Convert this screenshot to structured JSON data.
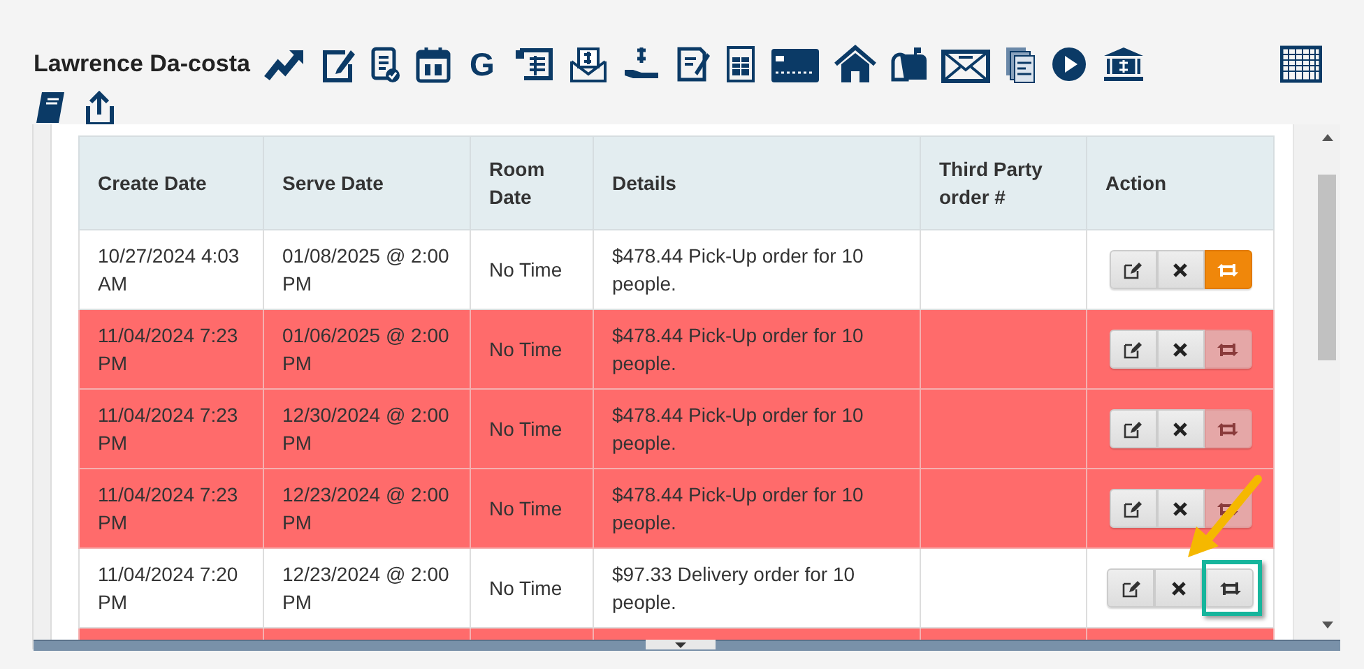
{
  "header": {
    "name": "Lawrence Da-costa",
    "letter_icon": "G"
  },
  "table": {
    "columns": [
      "Create Date",
      "Serve Date",
      "Room Date",
      "Details",
      "Third Party order #",
      "Action"
    ],
    "rows": [
      {
        "create_date": "10/27/2024 4:03 AM",
        "serve_date": "01/08/2025 @ 2:00 PM",
        "room_date": "No Time",
        "details": "$478.44 Pick-Up order for 10 people.",
        "highlighted": false,
        "repeat_active": true,
        "repeat_disabled": false,
        "callout": false
      },
      {
        "create_date": "11/04/2024 7:23 PM",
        "serve_date": "01/06/2025 @ 2:00 PM",
        "room_date": "No Time",
        "details": "$478.44 Pick-Up order for 10 people.",
        "highlighted": true,
        "repeat_active": false,
        "repeat_disabled": true,
        "callout": false
      },
      {
        "create_date": "11/04/2024 7:23 PM",
        "serve_date": "12/30/2024 @ 2:00 PM",
        "room_date": "No Time",
        "details": "$478.44 Pick-Up order for 10 people.",
        "highlighted": true,
        "repeat_active": false,
        "repeat_disabled": true,
        "callout": false
      },
      {
        "create_date": "11/04/2024 7:23 PM",
        "serve_date": "12/23/2024 @ 2:00 PM",
        "room_date": "No Time",
        "details": "$478.44 Pick-Up order for 10 people.",
        "highlighted": true,
        "repeat_active": false,
        "repeat_disabled": true,
        "callout": false
      },
      {
        "create_date": "11/04/2024 7:20 PM",
        "serve_date": "12/23/2024 @ 2:00 PM",
        "room_date": "No Time",
        "details": "$97.33 Delivery order for 10 people.",
        "highlighted": false,
        "repeat_active": false,
        "repeat_disabled": false,
        "callout": true
      },
      {
        "highlighted": true
      }
    ]
  }
}
